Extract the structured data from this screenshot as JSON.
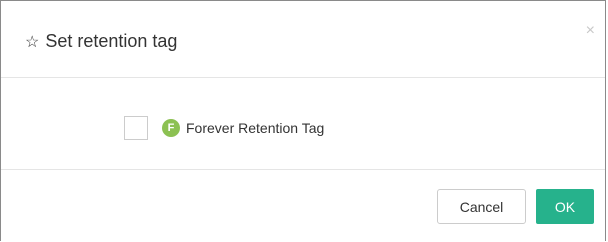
{
  "dialog": {
    "title": "Set retention tag",
    "title_icon": "star-outline-icon",
    "close_glyph": "×"
  },
  "tags": [
    {
      "label": "Forever Retention Tag",
      "badge_letter": "F",
      "badge_color": "#8cc152",
      "checked": false
    }
  ],
  "footer": {
    "cancel_label": "Cancel",
    "ok_label": "OK"
  },
  "colors": {
    "primary": "#26b28c",
    "badge": "#8cc152"
  }
}
